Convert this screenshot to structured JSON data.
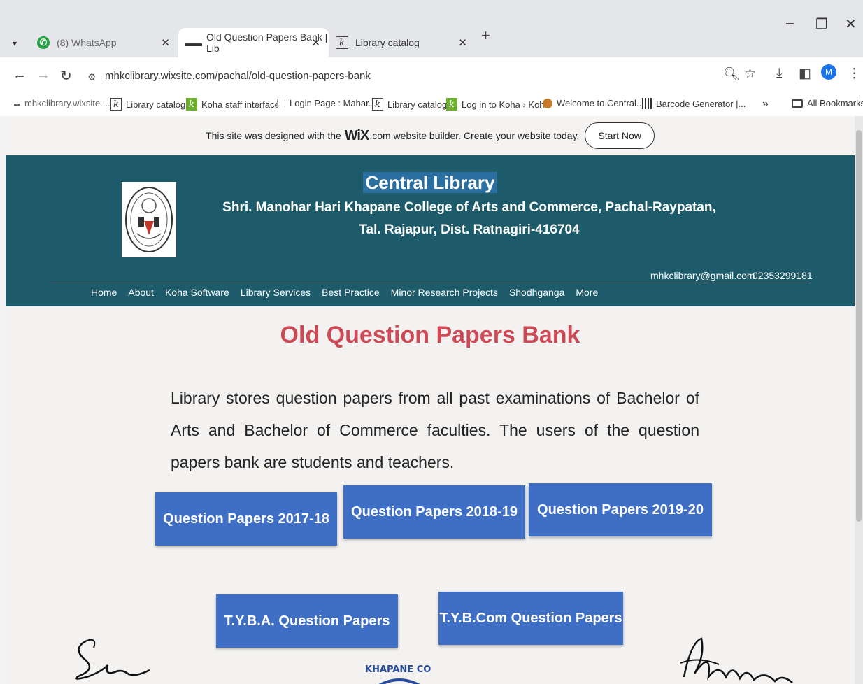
{
  "browser": {
    "tabs": [
      {
        "label": "(8) WhatsApp",
        "icon": "whatsapp-icon"
      },
      {
        "label": "Old Question Papers Bank | Lib",
        "icon": "wix-icon"
      },
      {
        "label": "Library catalog",
        "icon": "koha-icon"
      }
    ],
    "url": "mhkclibrary.wixsite.com/pachal/old-question-papers-bank",
    "profile_initial": "M",
    "bookmarks": [
      {
        "label": "mhkclibrary.wixsite...."
      },
      {
        "label": "Library catalog"
      },
      {
        "label": "Koha staff interface"
      },
      {
        "label": "Login Page : Mahar..."
      },
      {
        "label": "Library catalog"
      },
      {
        "label": "Log in to Koha › Koha"
      },
      {
        "label": "Welcome to Central..."
      },
      {
        "label": "Barcode Generator |..."
      }
    ],
    "bookmarks_overflow": "»",
    "all_bookmarks": "All Bookmarks"
  },
  "wix_banner": {
    "text_before": "This site was designed with the",
    "logo": "WiX",
    "text_after": ".com website builder. Create your website today.",
    "button": "Start Now"
  },
  "header": {
    "title": "Central Library",
    "college": "Shri. Manohar Hari Khapane College of Arts and Commerce, Pachal-Raypatan,",
    "address": "Tal. Rajapur, Dist. Ratnagiri-416704",
    "nav": [
      "Home",
      "About",
      "Koha Software",
      "Library Services",
      "Best Practice",
      "Minor Research Projects",
      "Shodhganga",
      "More"
    ],
    "email": "mhkclibrary@gmail.com",
    "phone": "02353299181"
  },
  "main": {
    "title": "Old Question Papers Bank",
    "intro": "Library stores question papers from all past examinations of Bachelor of Arts and Bachelor of Commerce faculties. The users of the question papers bank are students and teachers.",
    "buttons": {
      "qp_2017_18": "Question Papers 2017-18",
      "qp_2018_19": "Question Papers 2018-19",
      "qp_2019_20": "Question Papers 2019-20",
      "tyba": "T.Y.B.A. Question Papers",
      "tybcom": "T.Y.B.Com Question Papers"
    },
    "seal_text": "KHAPANE CO"
  },
  "colors": {
    "header_bg": "#1d5a6a",
    "title_red": "#cc4a55",
    "button_blue": "#3f6fc4"
  }
}
